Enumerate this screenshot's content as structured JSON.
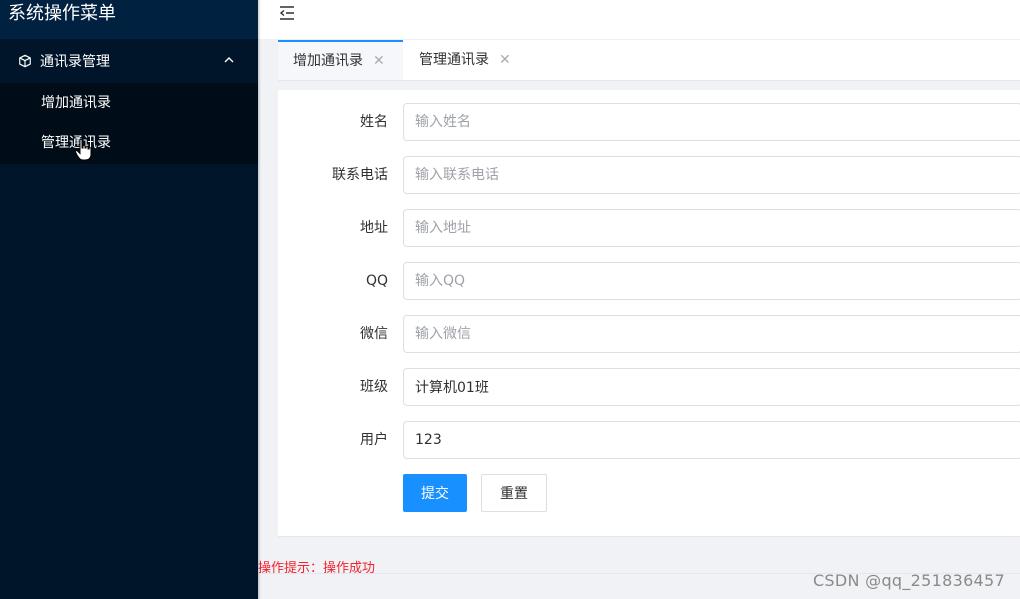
{
  "sidebar": {
    "title": "系统操作菜单",
    "group": {
      "label": "通讯录管理",
      "icon": "cube-icon",
      "expand_icon": "chevron-up-icon"
    },
    "items": [
      {
        "label": "增加通讯录"
      },
      {
        "label": "管理通讯录"
      }
    ]
  },
  "header": {
    "toggle_icon": "menu-fold-icon"
  },
  "tabs": [
    {
      "label": "增加通讯录",
      "active": true
    },
    {
      "label": "管理通讯录",
      "active": false
    }
  ],
  "form": {
    "fields": [
      {
        "label": "姓名",
        "placeholder": "输入姓名",
        "value": ""
      },
      {
        "label": "联系电话",
        "placeholder": "输入联系电话",
        "value": ""
      },
      {
        "label": "地址",
        "placeholder": "输入地址",
        "value": ""
      },
      {
        "label": "QQ",
        "placeholder": "输入QQ",
        "value": ""
      },
      {
        "label": "微信",
        "placeholder": "输入微信",
        "value": ""
      },
      {
        "label": "班级",
        "placeholder": "",
        "value": "计算机01班"
      },
      {
        "label": "用户",
        "placeholder": "",
        "value": "123"
      }
    ],
    "submit_label": "提交",
    "reset_label": "重置"
  },
  "status_message": "操作提示：操作成功",
  "watermark": "CSDN @qq_251836457",
  "colors": {
    "sidebar_bg": "#001529",
    "accent": "#1890ff",
    "error": "#f5222d"
  }
}
